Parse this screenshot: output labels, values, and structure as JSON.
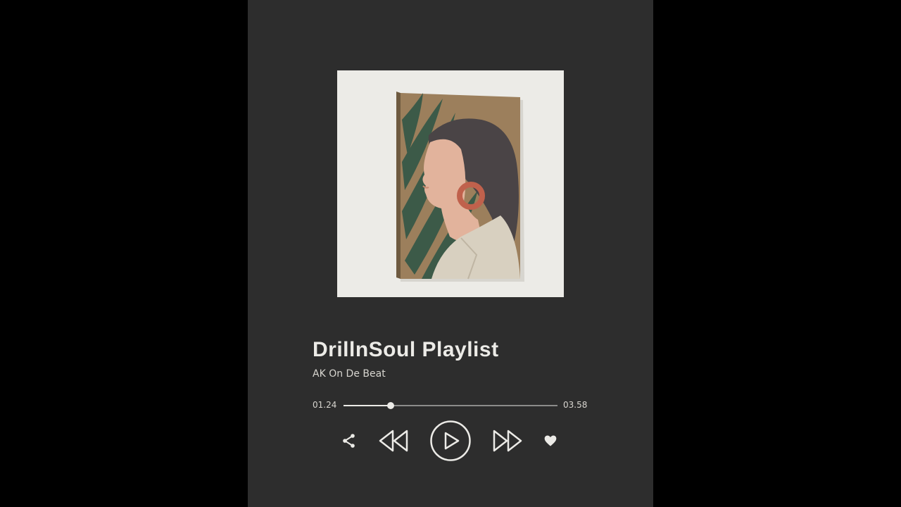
{
  "track": {
    "title": "DrillnSoul Playlist",
    "artist": "AK On De Beat"
  },
  "playback": {
    "elapsed": "01.24",
    "total": "03.58",
    "progress_fraction": 0.22
  },
  "controls": {
    "share_icon": "share-icon",
    "rewind_icon": "rewind-icon",
    "play_icon": "play-icon",
    "forward_icon": "fast-forward-icon",
    "like_icon": "heart-icon"
  },
  "colors": {
    "background": "#000000",
    "card": "#2d2d2d",
    "foreground": "#ecebe7",
    "track_line": "#8c8c8a",
    "art_backdrop": "#ecebe7",
    "art_canvas": "#9c7f5c",
    "art_leaf": "#3c5a48",
    "art_hair": "#4a4446",
    "art_skin": "#e2b39c",
    "art_earring": "#c0614c",
    "art_shirt": "#d8d0c0"
  }
}
